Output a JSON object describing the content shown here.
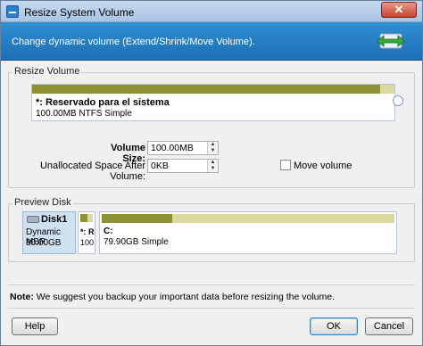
{
  "window": {
    "title": "Resize System Volume",
    "close_glyph": "✕"
  },
  "header": {
    "description": "Change dynamic volume (Extend/Shrink/Move Volume)."
  },
  "resize_volume": {
    "group_label": "Resize Volume",
    "partition": {
      "name": "*: Reservado para el sistema",
      "detail": "100.00MB NTFS Simple",
      "used_fraction": 0.96
    }
  },
  "form": {
    "volume_size_label": "Volume Size:",
    "volume_size_value": "100.00MB",
    "unallocated_after_label": "Unallocated Space After Volume:",
    "unallocated_after_value": "0KB",
    "move_volume_label": "Move volume",
    "move_volume_checked": false
  },
  "preview": {
    "group_label": "Preview Disk",
    "disk": {
      "name": "Disk1",
      "type": "Dynamic MBR",
      "size": "80.00GB"
    },
    "small_partition": {
      "name": "*: R",
      "detail": "100.",
      "used_fraction": 0.6
    },
    "c_partition": {
      "name": "C:",
      "detail": "79.90GB Simple",
      "used_fraction": 0.24
    }
  },
  "note": {
    "label": "Note:",
    "text": " We suggest you backup your important data before resizing the volume."
  },
  "buttons": {
    "help": "Help",
    "ok": "OK",
    "cancel": "Cancel"
  },
  "colors": {
    "header_bg": "#1e6fb5",
    "bar_used": "#8c9232",
    "bar_free": "#d9d9a0",
    "disk_bg": "#cfe0f1"
  }
}
